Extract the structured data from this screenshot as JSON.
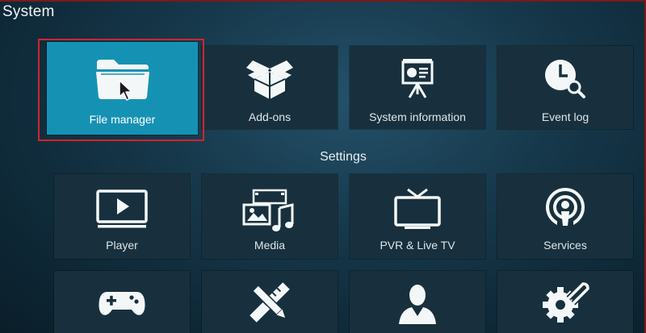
{
  "window": {
    "title": "System"
  },
  "top_tiles": [
    {
      "label": "File manager",
      "icon": "folder-icon",
      "selected": true
    },
    {
      "label": "Add-ons",
      "icon": "open-box-icon",
      "selected": false
    },
    {
      "label": "System information",
      "icon": "presentation-board-icon",
      "selected": false
    },
    {
      "label": "Event log",
      "icon": "clock-search-icon",
      "selected": false
    }
  ],
  "settings": {
    "heading": "Settings",
    "tiles": [
      {
        "label": "Player",
        "icon": "video-player-icon"
      },
      {
        "label": "Media",
        "icon": "media-icon"
      },
      {
        "label": "PVR & Live TV",
        "icon": "tv-icon"
      },
      {
        "label": "Services",
        "icon": "podcast-icon"
      },
      {
        "label": "",
        "icon": "gamepad-icon"
      },
      {
        "label": "",
        "icon": "pencil-ruler-icon"
      },
      {
        "label": "",
        "icon": "user-profile-icon"
      },
      {
        "label": "",
        "icon": "gear-wrench-icon"
      }
    ]
  },
  "colors": {
    "selected_tile": "#1592b3",
    "tile": "#18303d",
    "highlight_frame": "#d1252b"
  }
}
